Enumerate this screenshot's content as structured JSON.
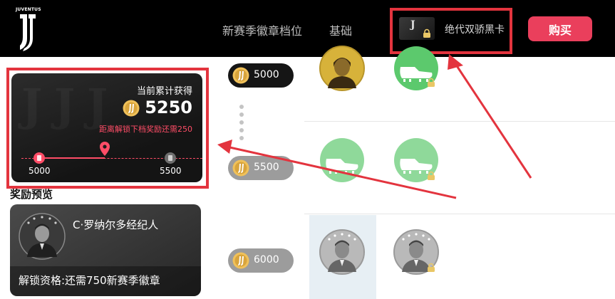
{
  "topbar": {
    "logo_text": "JUVENTUS",
    "tabs": [
      "新赛季徽章档位",
      "基础"
    ],
    "card_name": "绝代双骄黑卡",
    "buy_label": "购买"
  },
  "progress": {
    "title": "当前累计获得",
    "value": "5250",
    "hint": "距离解锁下档奖励还需250",
    "from_label": "5000",
    "to_label": "5500",
    "fraction": 0.5
  },
  "preview": {
    "title": "奖励预览",
    "name": "C·罗纳尔多经纪人",
    "unlock_text": "解锁资格:还需750新赛季徽章"
  },
  "tiers": [
    {
      "value": "5000",
      "style": "dark"
    },
    {
      "value": "5500",
      "style": "gray"
    },
    {
      "value": "6000",
      "style": "gray"
    }
  ],
  "colors": {
    "accent": "#ea3f5c",
    "progress_red": "#ff4d67",
    "reward_green": "#5cc96d",
    "highlight_red": "#e3343e"
  }
}
